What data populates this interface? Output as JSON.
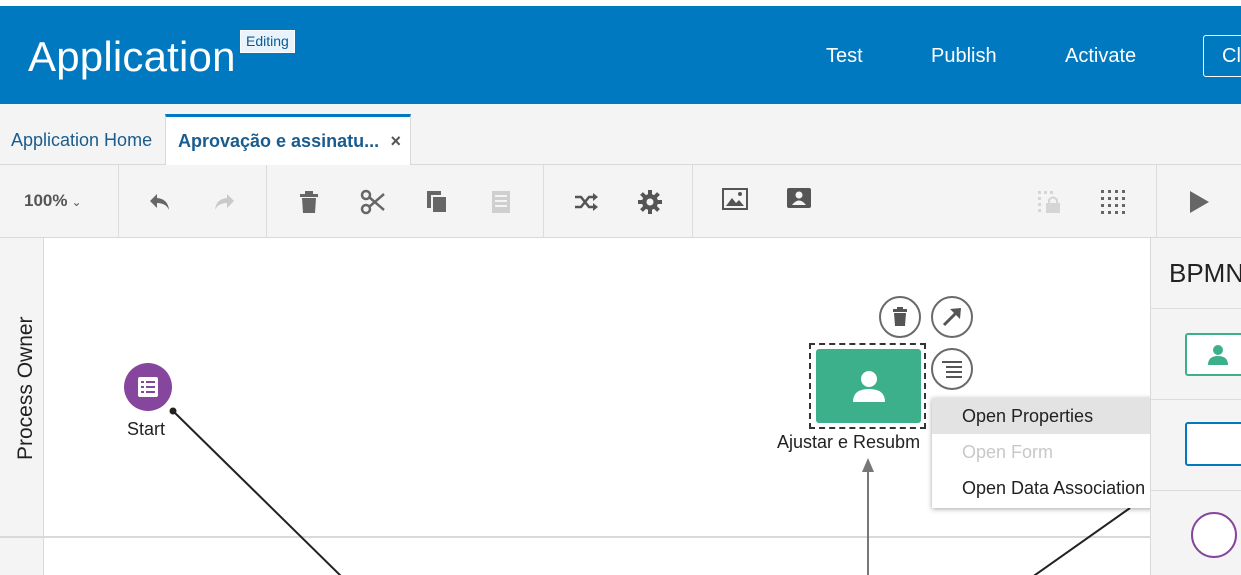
{
  "header": {
    "title": "Application",
    "badge": "Editing",
    "buttons": {
      "test": "Test",
      "publish": "Publish",
      "activate": "Activate",
      "close": "Cl"
    }
  },
  "tabs": [
    {
      "label": "Application Home"
    },
    {
      "label": "Aprovação e assinatu...",
      "close": "×"
    }
  ],
  "toolbar": {
    "zoom": "100%",
    "icons": [
      "undo-icon",
      "redo-icon",
      "delete-icon",
      "cut-icon",
      "copy-icon",
      "paste-icon",
      "shuffle-icon",
      "gear-icon",
      "image-icon",
      "contact-card-icon",
      "lock-icon",
      "grid-icon",
      "play-icon"
    ]
  },
  "canvas": {
    "lane_label": "Process Owner",
    "start_label": "Start",
    "task_label": "Ajustar e Resubm"
  },
  "context_menu": {
    "items": [
      {
        "label": "Open Properties",
        "state": "highlighted"
      },
      {
        "label": "Open Form",
        "state": "disabled"
      },
      {
        "label": "Open Data Association",
        "state": "normal"
      }
    ]
  },
  "right_panel": {
    "title": "BPMN"
  },
  "colors": {
    "header_blue": "#0079c1",
    "task_green": "#3cb08a",
    "start_purple": "#86469d"
  }
}
